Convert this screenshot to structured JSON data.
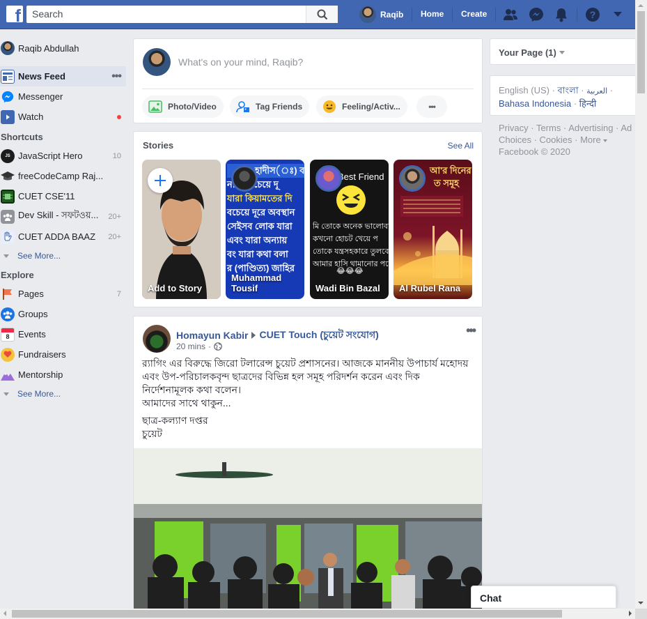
{
  "topbar": {
    "search_placeholder": "Search",
    "profile_name": "Raqib",
    "home": "Home",
    "create": "Create",
    "brand_color": "#4267b2"
  },
  "left": {
    "profile_name": "Raqib Abdullah",
    "items": [
      {
        "label": "News Feed",
        "icon": "news-feed-icon"
      },
      {
        "label": "Messenger",
        "icon": "messenger-icon"
      },
      {
        "label": "Watch",
        "icon": "watch-icon"
      }
    ],
    "shortcuts_header": "Shortcuts",
    "shortcuts": [
      {
        "label": "JavaScript Hero",
        "count": "10"
      },
      {
        "label": "freeCodeCamp Raj...",
        "count": ""
      },
      {
        "label": "CUET CSE'11",
        "count": ""
      },
      {
        "label": "Dev Skill - সফটওয়...",
        "count": "20+"
      },
      {
        "label": "CUET ADDA BAAZ",
        "count": "20+"
      }
    ],
    "see_more": "See More...",
    "explore_header": "Explore",
    "explore": [
      {
        "label": "Pages",
        "count": "7"
      },
      {
        "label": "Groups",
        "count": ""
      },
      {
        "label": "Events",
        "count": ""
      },
      {
        "label": "Fundraisers",
        "count": ""
      },
      {
        "label": "Mentorship",
        "count": ""
      }
    ],
    "events_day": "8"
  },
  "composer": {
    "prompt": "What's on your mind, Raqib?",
    "photo_video": "Photo/Video",
    "tag_friends": "Tag Friends",
    "feeling": "Feeling/Activ...",
    "more": "•••"
  },
  "stories": {
    "title": "Stories",
    "see_all": "See All",
    "items": [
      {
        "name": "Add to Story"
      },
      {
        "name": "Muhammad Tousif"
      },
      {
        "name": "Wadi Bin Bazal"
      },
      {
        "name": "Al Rubel Rana"
      }
    ],
    "story2_text": [
      "হাদীস(ঃ) বলেছেন",
      "নাম সবচেয়ে দূ",
      "যারা কিয়ামতের দি",
      "বচেয়ে দূরে অবস্থান",
      "সেইসব লোক যারা",
      "এবং যারা অন্যায়",
      "বং যারা কথা বলা",
      "র (পাণ্ডিত্য) জাহির"
    ],
    "story3_text": [
      "Best Friend",
      "মি তোকে অনেক ভালোবা",
      "কখনো হোচট খেয়ে প",
      "তোকে যন্ত্রসহকারে তুলবো",
      "আমার হাসি থামানোর পরে",
      "😂😂😂"
    ],
    "story4_text": [
      "আ'র দিনের",
      "ত সমূহ"
    ]
  },
  "post": {
    "author": "Homayun Kabir",
    "group": "CUET Touch (চুয়েট সংযোগ)",
    "time": "20 mins",
    "body_lines": [
      "র‍্যাগিং এর বিরুদ্ধে জিরো টলারেন্স চুয়েট প্রশাসনের। আজকে মাননীয় উপাচার্য মহোদয় এবং উপ-পরিচালকবৃন্দ ছাত্রদের বিভিন্ন হল সমূহ পরিদর্শন করেন এবং দিক নির্দেশনামূলক কথা বলেন।",
      "আমাদের সাথে থাকুন...",
      "ছাত্র-কল্যাণ দপ্তর",
      "চুয়েট"
    ]
  },
  "right": {
    "your_page": "Your Page (1)",
    "lang_en": "English (US)",
    "lang_bn": "বাংলা",
    "lang_ar": "العربية",
    "lang_id": "Bahasa Indonesia",
    "lang_hi": "हिन्दी",
    "footer_links": [
      "Privacy",
      "Terms",
      "Advertising",
      "Ad Choices",
      "Cookies",
      "More"
    ],
    "copyright": "Facebook © 2020"
  },
  "chat": {
    "label": "Chat"
  }
}
